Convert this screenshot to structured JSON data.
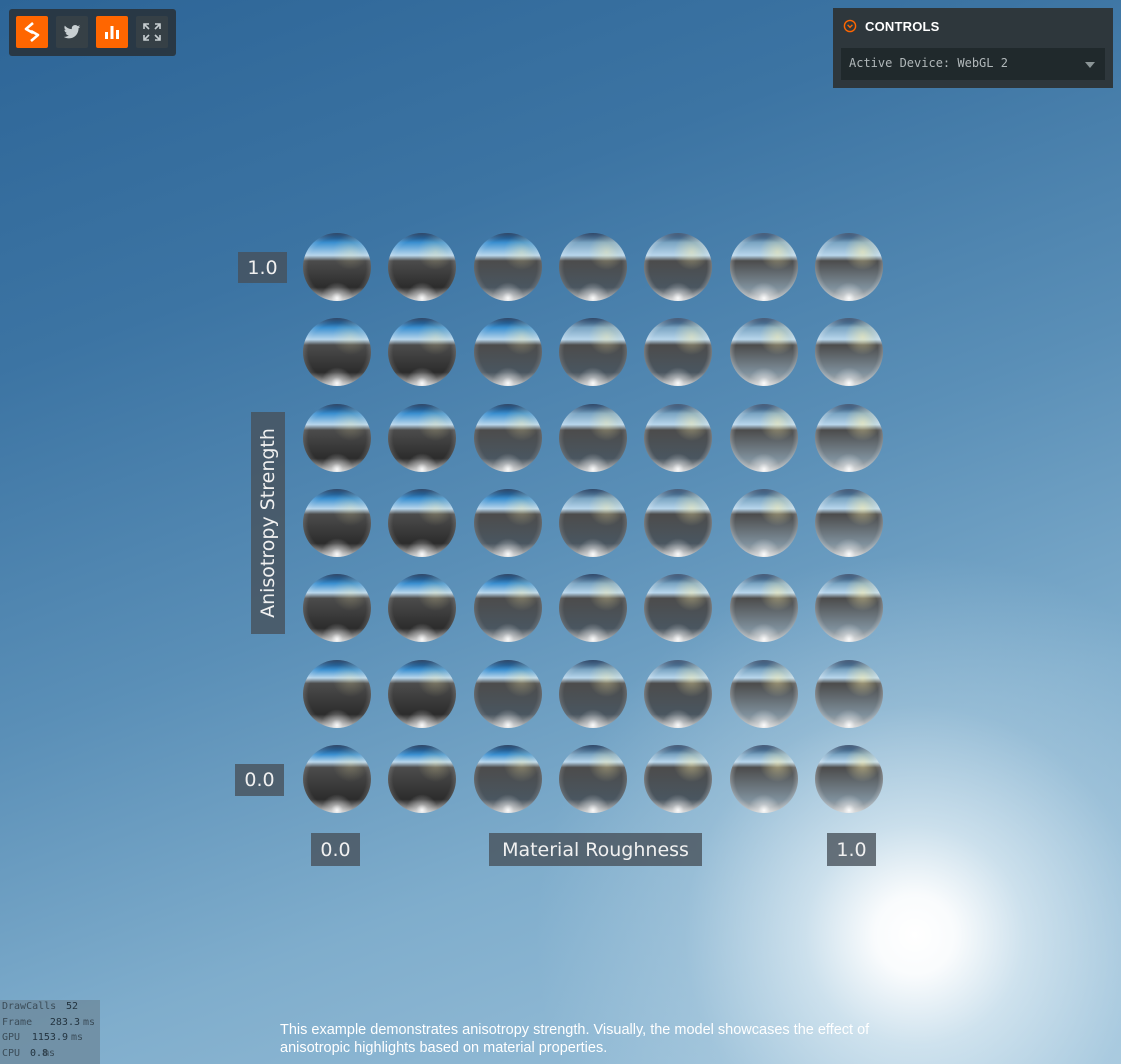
{
  "toolbar": {
    "buttons": [
      {
        "name": "playcanvas-logo-icon",
        "style": "orange"
      },
      {
        "name": "twitter-icon",
        "style": "dark"
      },
      {
        "name": "stats-toggle-icon",
        "style": "orange"
      },
      {
        "name": "fullscreen-icon",
        "style": "dark"
      }
    ]
  },
  "controls": {
    "title": "CONTROLS",
    "device_select_value": "Active Device: WebGL 2",
    "accent_color": "#ff6600"
  },
  "scene": {
    "rows": 7,
    "cols": 7,
    "axis_y_label": "Anisotropy Strength",
    "axis_y_max": "1.0",
    "axis_y_min": "0.0",
    "axis_x_label": "Material Roughness",
    "axis_x_min": "0.0",
    "axis_x_max": "1.0"
  },
  "stats": [
    {
      "name": "DrawCalls",
      "value": "52",
      "unit": ""
    },
    {
      "name": "Frame",
      "value": "283.3",
      "unit": "ms"
    },
    {
      "name": "GPU",
      "value": "1153.9",
      "unit": "ms"
    },
    {
      "name": "CPU",
      "value": "0.8",
      "unit": "ms"
    }
  ],
  "description": "This example demonstrates anisotropy strength. Visually, the model showcases the effect of anisotropic highlights based on material properties."
}
